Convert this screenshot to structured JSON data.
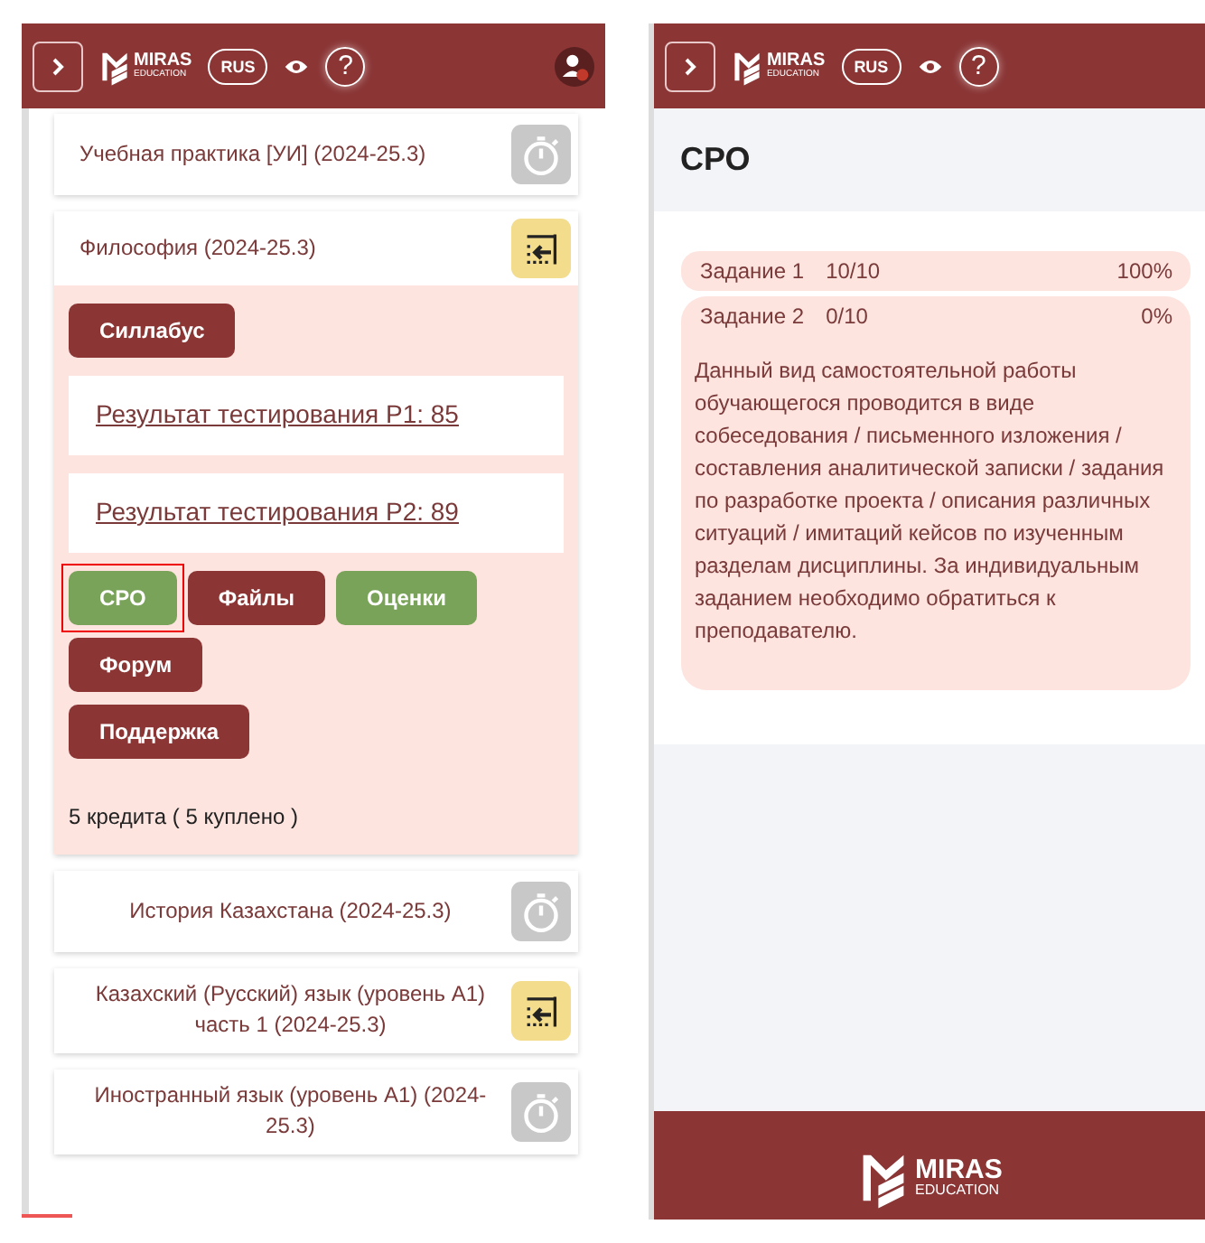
{
  "left_screen": {
    "header": {
      "logo_title": "MIRAS",
      "logo_subtitle": "EDUCATION",
      "language": "RUS",
      "help": "?"
    },
    "courses": [
      {
        "title": "Учебная практика [УИ] (2024-25.3)",
        "kind": "timer",
        "expanded": false
      },
      {
        "title": "Философия (2024-25.3)",
        "kind": "toggle",
        "expanded": true,
        "syllabus": "Силлабус",
        "results": [
          "Результат тестирования Р1: 85",
          "Результат тестирования Р2: 89"
        ],
        "buttons": [
          {
            "label": "СРО",
            "color": "#7aa35a",
            "highlighted": true
          },
          {
            "label": "Файлы",
            "color": "#8b3535",
            "highlighted": false
          },
          {
            "label": "Оценки",
            "color": "#7aa35a",
            "highlighted": false
          },
          {
            "label": "Форум",
            "color": "#8b3535",
            "highlighted": false
          },
          {
            "label": "Поддержка",
            "color": "#8b3535",
            "highlighted": false
          }
        ],
        "credits": "5 кредита ( 5 куплено )"
      },
      {
        "title": "История Казахстана (2024-25.3)",
        "kind": "timer",
        "expanded": false
      },
      {
        "title": "Казахский (Русский) язык (уровень А1) часть 1 (2024-25.3)",
        "kind": "toggle",
        "expanded": false
      },
      {
        "title": "Иностранный язык (уровень А1) (2024-25.3)",
        "kind": "timer",
        "expanded": false
      }
    ]
  },
  "right_screen": {
    "header": {
      "logo_title": "MIRAS",
      "logo_subtitle": "EDUCATION",
      "language": "RUS",
      "help": "?"
    },
    "page_title": "СРО",
    "tasks": [
      {
        "label": "Задание 1",
        "score": "10/10",
        "percent": "100%",
        "expanded": false
      },
      {
        "label": "Задание 2",
        "score": "0/10",
        "percent": "0%",
        "expanded": true,
        "description": "Данный вид самостоятельной работы обучающегося проводится в виде собеседования / письменного изложения / составления аналитической записки / задания по разработке проекта / описания различных ситуаций / имитаций кейсов по изученным разделам дисциплины. За индивидуальным заданием необходимо обратиться к преподавателю."
      }
    ],
    "footer": {
      "logo_title": "MIRAS",
      "logo_subtitle": "EDUCATION"
    }
  }
}
